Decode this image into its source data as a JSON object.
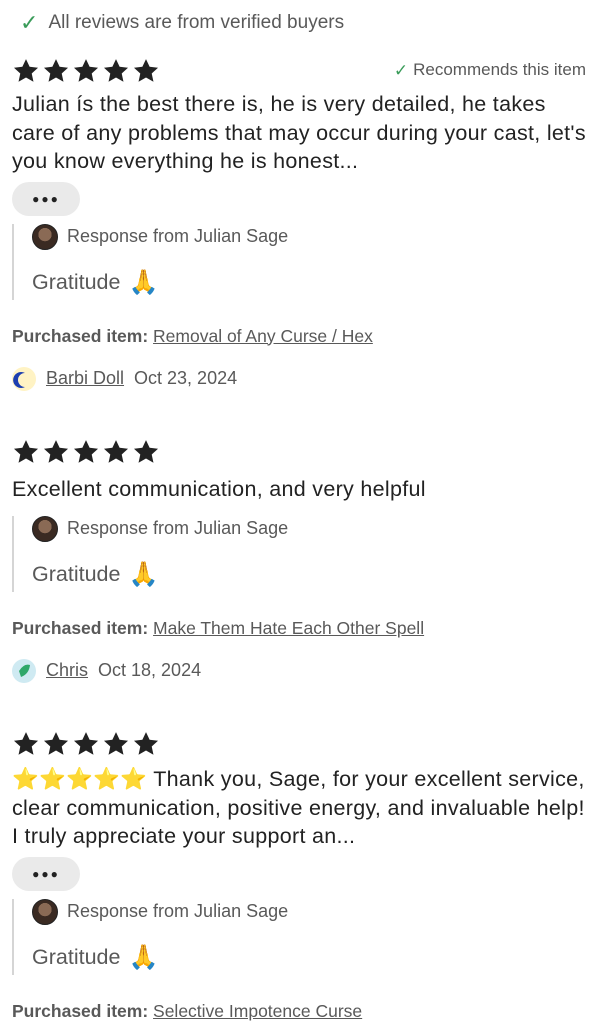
{
  "banner": {
    "text": "All reviews are from verified buyers"
  },
  "reviews": [
    {
      "rating": 5,
      "recommends": "Recommends this item",
      "text": "Julian ís the best there is, he is very detailed, he takes care of any problems that may occur during your cast, let's you know everything he is honest...",
      "more_label": "●●●",
      "response_header": "Response from Julian Sage",
      "response_text": "Gratitude",
      "response_emoji": "🙏",
      "purchased_label": "Purchased item:",
      "purchased_item": "Removal of Any Curse / Hex",
      "reviewer_name": "Barbi Doll",
      "date": "Oct 23, 2024"
    },
    {
      "rating": 5,
      "text": "Excellent communication, and very helpful",
      "response_header": "Response from Julian Sage",
      "response_text": "Gratitude",
      "response_emoji": "🙏",
      "purchased_label": "Purchased item:",
      "purchased_item": "Make Them Hate Each Other Spell",
      "reviewer_name": "Chris",
      "date": "Oct 18, 2024"
    },
    {
      "rating": 5,
      "text": "⭐⭐⭐⭐⭐ Thank you, Sage, for your excellent service, clear communication, positive energy, and invaluable help! I truly appreciate your support an...",
      "more_label": "●●●",
      "response_header": "Response from Julian Sage",
      "response_text": "Gratitude",
      "response_emoji": "🙏",
      "purchased_label": "Purchased item:",
      "purchased_item": "Selective Impotence Curse"
    }
  ],
  "colors": {
    "star": "#222222",
    "check": "#3a9c5a",
    "muted": "#595959"
  }
}
